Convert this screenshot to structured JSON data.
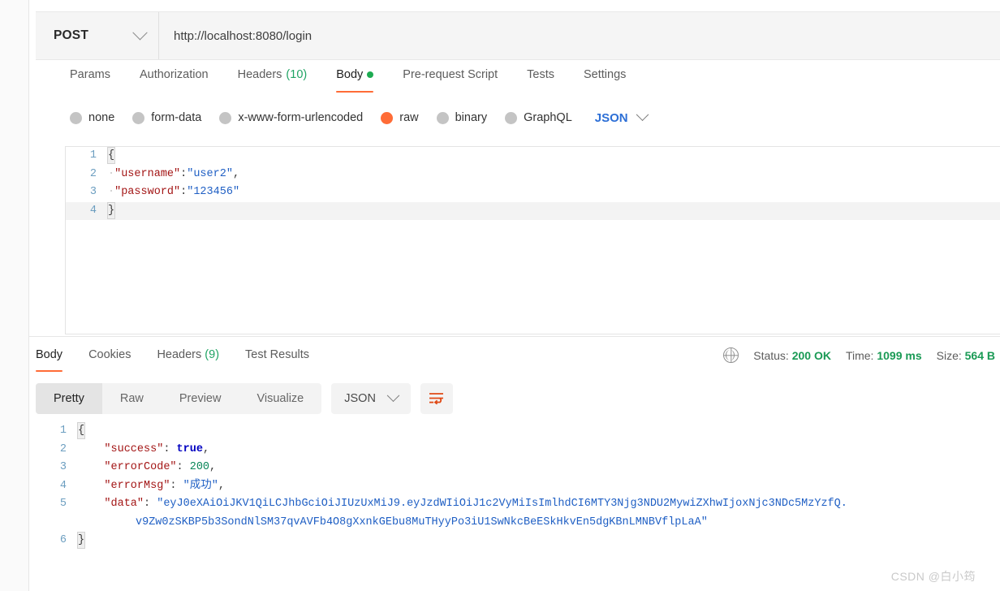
{
  "request": {
    "method": "POST",
    "url": "http://localhost:8080/login",
    "tabs": [
      {
        "label": "Params",
        "active": false
      },
      {
        "label": "Authorization",
        "active": false
      },
      {
        "label": "Headers",
        "count": "(10)",
        "active": false
      },
      {
        "label": "Body",
        "active": true,
        "dot": true
      },
      {
        "label": "Pre-request Script",
        "active": false
      },
      {
        "label": "Tests",
        "active": false
      },
      {
        "label": "Settings",
        "active": false
      }
    ],
    "body_types": [
      {
        "label": "none",
        "selected": false
      },
      {
        "label": "form-data",
        "selected": false
      },
      {
        "label": "x-www-form-urlencoded",
        "selected": false
      },
      {
        "label": "raw",
        "selected": true
      },
      {
        "label": "binary",
        "selected": false
      },
      {
        "label": "GraphQL",
        "selected": false
      }
    ],
    "format": "JSON",
    "editor": {
      "lines": [
        "1",
        "2",
        "3",
        "4"
      ],
      "line1_brace": "{",
      "line2_key": "\"username\"",
      "line2_colon": ":",
      "line2_val": "\"user2\"",
      "line2_comma": ",",
      "line3_key": "\"password\"",
      "line3_colon": ":",
      "line3_val": "\"123456\"",
      "line4_brace": "}"
    }
  },
  "response": {
    "tabs": [
      {
        "label": "Body",
        "active": true
      },
      {
        "label": "Cookies",
        "active": false
      },
      {
        "label": "Headers",
        "count": "(9)",
        "active": false
      },
      {
        "label": "Test Results",
        "active": false
      }
    ],
    "meta": {
      "status_label": "Status:",
      "status_value": "200 OK",
      "time_label": "Time:",
      "time_value": "1099 ms",
      "size_label": "Size:",
      "size_value": "564 B"
    },
    "view_modes": [
      {
        "label": "Pretty",
        "active": true
      },
      {
        "label": "Raw",
        "active": false
      },
      {
        "label": "Preview",
        "active": false
      },
      {
        "label": "Visualize",
        "active": false
      }
    ],
    "format": "JSON",
    "body": {
      "lines": [
        "1",
        "2",
        "3",
        "4",
        "5",
        "6"
      ],
      "line1_brace": "{",
      "line2_key": "\"success\"",
      "line2_val": "true",
      "line2_comma": ",",
      "line3_key": "\"errorCode\"",
      "line3_val": "200",
      "line3_comma": ",",
      "line4_key": "\"errorMsg\"",
      "line4_val": "\"成功\"",
      "line4_comma": ",",
      "line5_key": "\"data\"",
      "line5_val_part1": "\"eyJ0eXAiOiJKV1QiLCJhbGciOiJIUzUxMiJ9.eyJzdWIiOiJ1c2VyMiIsImlhdCI6MTY3Njg3NDU2MywiZXhwIjoxNjc3NDc5MzYzfQ.",
      "line5_val_part2": "v9Zw0zSKBP5b3SondNlSM37qvAVFb4O8gXxnkGEbu8MuTHyyPo3iU1SwNkcBeESkHkvEn5dgKBnLMNBVflpLaA\"",
      "line6_brace": "}"
    }
  },
  "watermark": "CSDN @白小筠",
  "colors": {
    "accent": "#ff6c37",
    "success": "#1a9a55",
    "link": "#2d6fd6",
    "string": "#1f5fc4",
    "key": "#a31515",
    "number": "#098658",
    "boolean": "#0000c0"
  }
}
